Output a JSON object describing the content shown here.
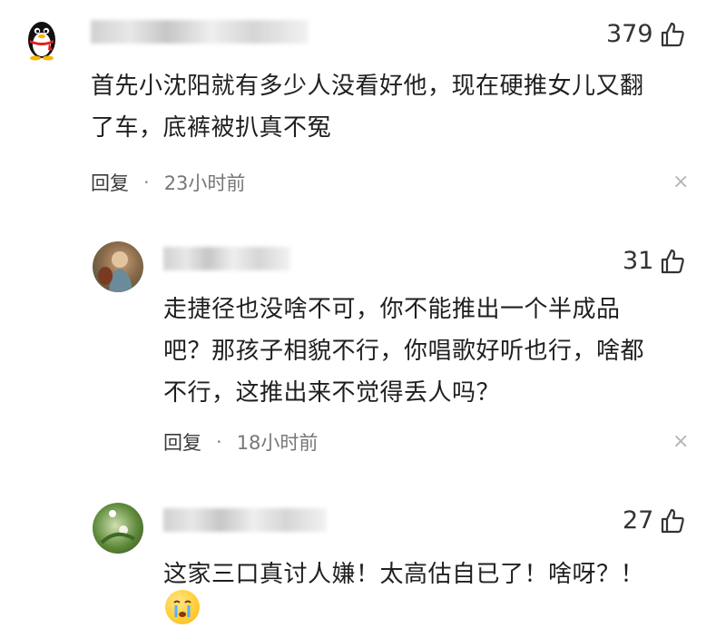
{
  "comments": [
    {
      "likes": "379",
      "lines": [
        "首先小沈阳就有多少人没看好他，现在硬推女儿又翻",
        "了车，底裤被扒真不冤"
      ],
      "reply_label": "回复",
      "time": "23小时前",
      "close": "×"
    },
    {
      "likes": "31",
      "lines": [
        "走捷径也没啥不可，你不能推出一个半成品",
        "吧？那孩子相貌不行，你唱歌好听也行，啥都",
        "不行，这推出来不觉得丢人吗？"
      ],
      "reply_label": "回复",
      "time": "18小时前",
      "close": "×"
    },
    {
      "likes": "27",
      "lines": [
        "这家三口真讨人嫌！太高估自已了！啥呀？！"
      ]
    }
  ],
  "dot": "·",
  "icons": {
    "like": "thumbs-up-icon",
    "close": "close-icon"
  }
}
